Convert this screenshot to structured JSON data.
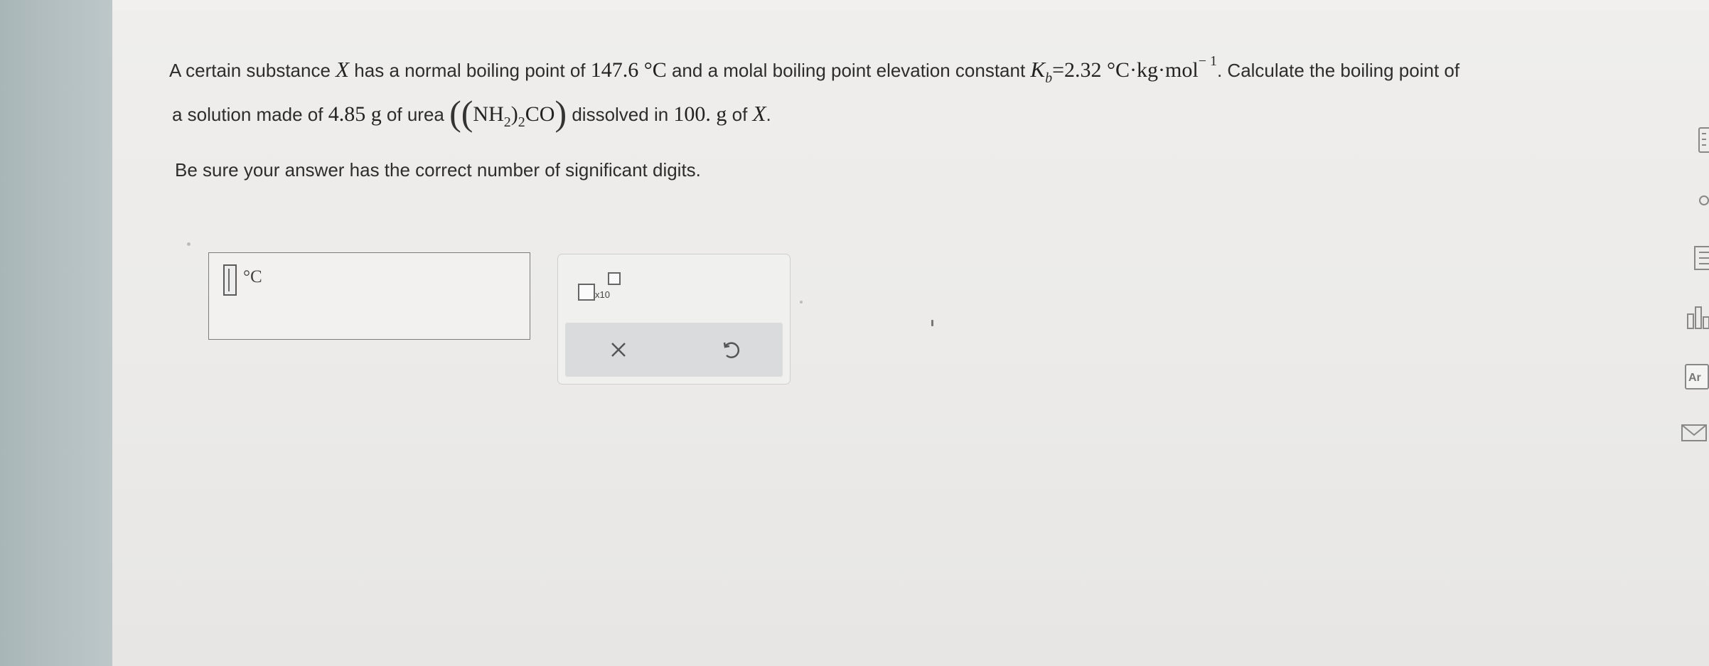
{
  "question": {
    "line1_a": "A certain substance ",
    "line1_var": "X",
    "line1_b": " has a normal boiling point of ",
    "bp_value": "147.6 °C",
    "line1_c": " and a molal boiling point elevation constant ",
    "kb_symbol": "K",
    "kb_sub": "b",
    "kb_value": "=2.32 °C·kg·mol",
    "kb_exp": "− 1",
    "line1_d": ". Calculate the boiling point of",
    "line2_a": "a solution made of ",
    "mass_value": "4.85 g",
    "line2_b": " of urea ",
    "formula_open": "((",
    "formula_nh": "NH",
    "formula_sub1": "2",
    "formula_close1": ")",
    "formula_sub2": "2",
    "formula_co": "CO",
    "formula_close2": ")",
    "line2_c": " dissolved in ",
    "solvent_mass": "100. g",
    "line2_d": " of ",
    "line2_var": "X",
    "line2_e": ".",
    "instruction": "Be sure your answer has the correct number of significant digits."
  },
  "answer": {
    "value": "",
    "unit": "°C"
  },
  "toolbar": {
    "sci_label": "x10",
    "clear_icon": "x-icon",
    "undo_icon": "undo-icon"
  },
  "sidebar_icons": [
    "calculator-icon",
    "circle-icon",
    "periodic-table-icon",
    "chart-icon",
    "aleks-reference-icon",
    "mail-icon"
  ],
  "sidebar_text": {
    "ar_label": "Ar"
  }
}
